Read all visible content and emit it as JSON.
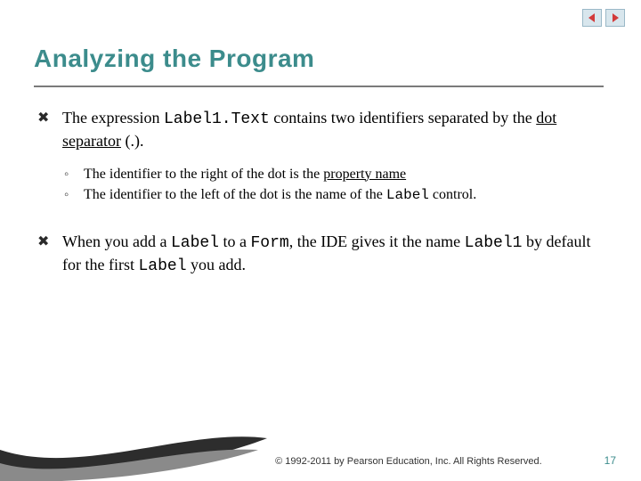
{
  "nav": {
    "prev_icon": "triangle-left-icon",
    "next_icon": "triangle-right-icon",
    "arrow_fill": "#d23a3a",
    "btn_bg": "#d8e6ed"
  },
  "title": "Analyzing the Program",
  "bullets": [
    {
      "pre": "The expression ",
      "code": "Label1.Text",
      "post": " contains two identifiers separated by the ",
      "term": "dot separator",
      "tail": " (.).",
      "sub": [
        {
          "pre": "The identifier to the right of the dot is the ",
          "term": "property name",
          "tail": ""
        },
        {
          "pre": "The identifier to the left of the dot is the name of the ",
          "code": "Label",
          "tail": " control."
        }
      ]
    },
    {
      "segments": [
        {
          "t": "When you add a "
        },
        {
          "c": "Label"
        },
        {
          "t": " to a "
        },
        {
          "c": "Form"
        },
        {
          "t": ", the IDE gives it the name "
        },
        {
          "c": "Label1"
        },
        {
          "t": " by default for the first "
        },
        {
          "c": "Label"
        },
        {
          "t": " you add."
        }
      ]
    }
  ],
  "footer": {
    "copyright": "© 1992-2011 by Pearson Education, Inc. All Rights Reserved.",
    "page": "17"
  }
}
